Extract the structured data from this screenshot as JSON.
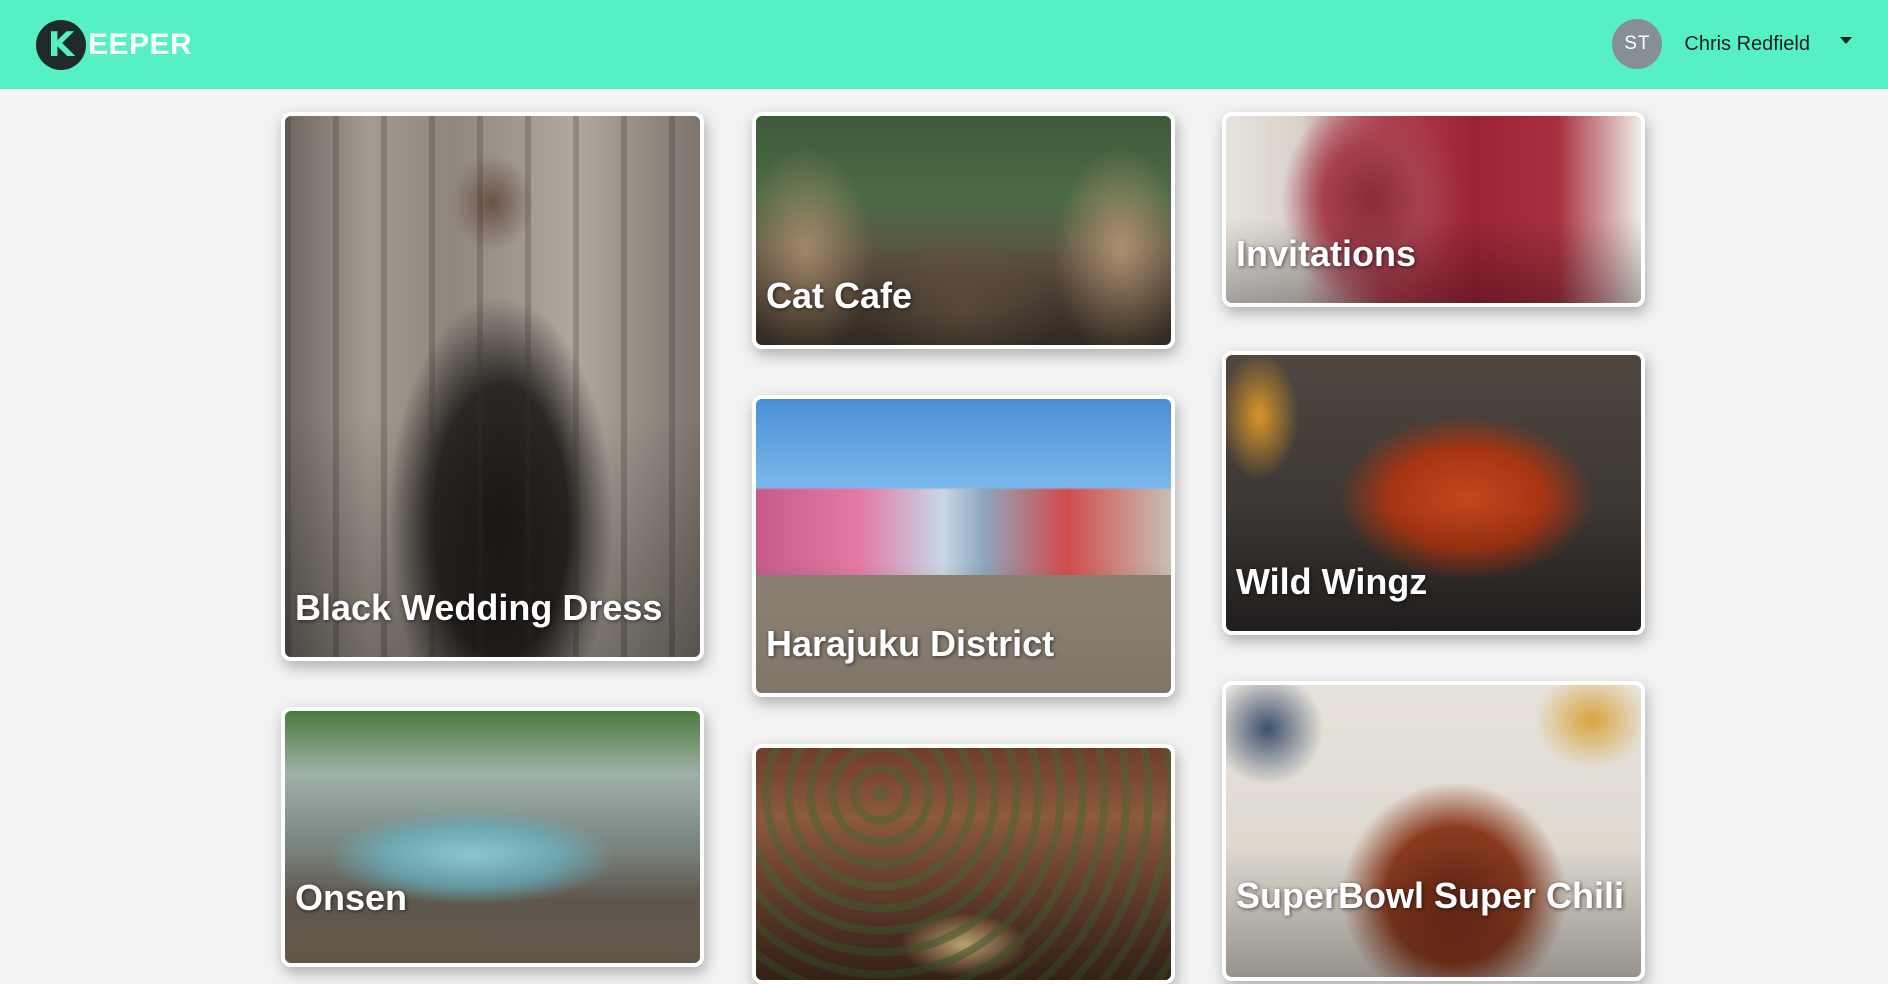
{
  "navbar": {
    "logo_letter": "K",
    "logo_text": "EEPER",
    "avatar_initials": "ST",
    "user_name": "Chris Redfield",
    "color": "#55f0c4"
  },
  "keeps": [
    {
      "title": "Black Wedding Dress",
      "image": "bride-black-gown-forest"
    },
    {
      "title": "Cat Cafe",
      "image": "cat-cafe-interior"
    },
    {
      "title": "Invitations",
      "image": "red-lace-wedding-invitation"
    },
    {
      "title": "Harajuku District",
      "image": "harajuku-street-crowd"
    },
    {
      "title": "Wild Wingz",
      "image": "chicken-wings-plate"
    },
    {
      "title": "Onsen",
      "image": "hot-spring-rocks"
    },
    {
      "title": "",
      "image": "floral-ceiling-venue"
    },
    {
      "title": "SuperBowl Super Chili",
      "image": "chili-bowl"
    }
  ]
}
